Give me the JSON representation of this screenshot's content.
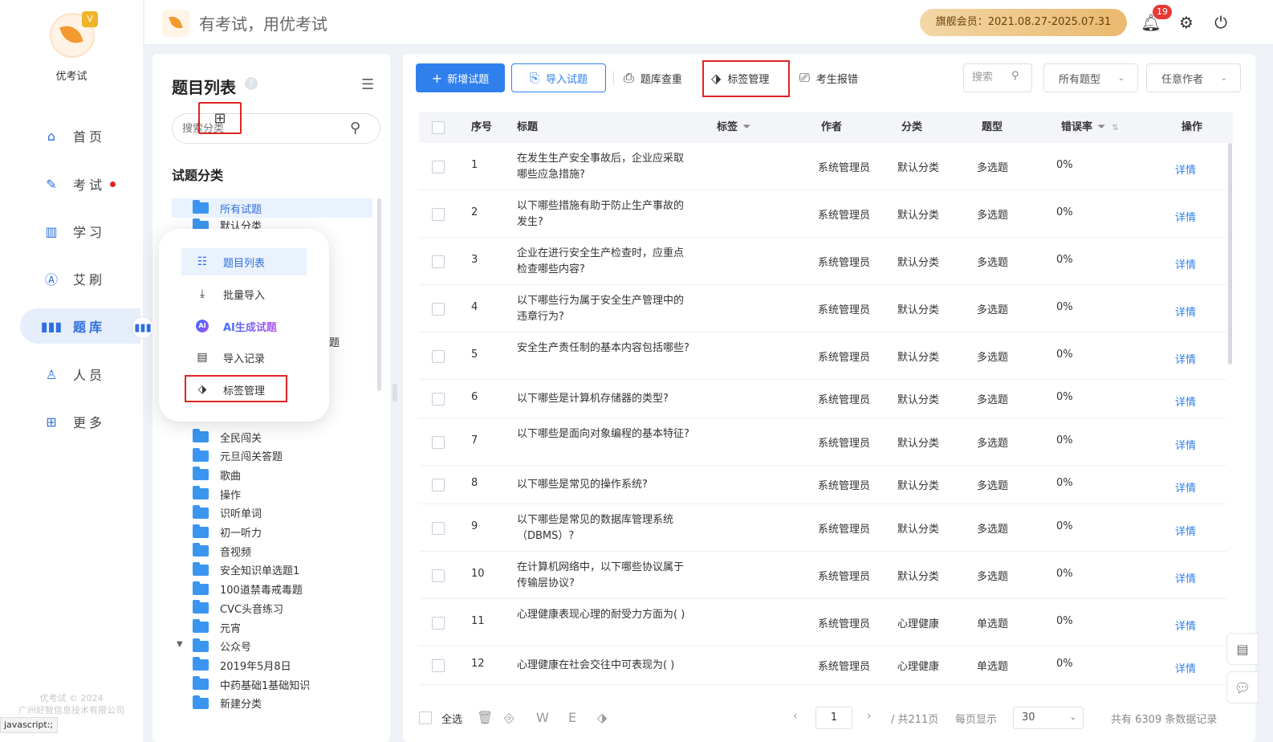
{
  "app": {
    "name": "优考试",
    "slogan": "有考试，用优考试",
    "logo_badge": "V"
  },
  "nav": {
    "items": [
      {
        "icon": "home-icon",
        "label": "首页"
      },
      {
        "icon": "exam-icon",
        "label": "考试"
      },
      {
        "icon": "book-icon",
        "label": "学习"
      },
      {
        "icon": "ai-brush-icon",
        "label": "艾刷"
      },
      {
        "icon": "question-bank-icon",
        "label": "题库"
      },
      {
        "icon": "user-icon",
        "label": "人员"
      },
      {
        "icon": "more-icon",
        "label": "更多"
      }
    ],
    "active": "题库",
    "copyright_line1": "优考试 © 2024",
    "copyright_line2": "广州好智信息技术有限公司"
  },
  "topbar": {
    "vip_text": "旗舰会员：2021.08.27-2025.07.31",
    "bell_count": "19"
  },
  "statusbar": "javascript:;",
  "midpanel": {
    "title": "题目列表",
    "help": "?",
    "search_placeholder": "搜索分类",
    "category_label": "试题分类",
    "categories_top": [
      "所有试题",
      "默认分类"
    ],
    "categories_bottom": [
      "全民闯关",
      "元旦闯关答题",
      "歌曲",
      "操作",
      "识听单词",
      "初一听力",
      "音视频",
      "安全知识单选题1",
      "100道禁毒戒毒题",
      "CVC头音练习",
      "元宵",
      "公众号",
      "2019年5月8日",
      "中药基础1基础知识",
      "新建分类"
    ],
    "behind_text": "题"
  },
  "popup": {
    "items": [
      "题目列表",
      "批量导入",
      "AI生成试题",
      "导入记录",
      "标签管理"
    ],
    "ai_icon_text": "AI"
  },
  "toolbar": {
    "add_label": "新增试题",
    "import_label": "导入试题",
    "dedupe_label": "题库查重",
    "tag_label": "标签管理",
    "report_label": "考生报错",
    "search_placeholder": "搜索",
    "type_filter": "所有题型",
    "author_filter": "任意作者"
  },
  "table": {
    "headers": {
      "seq": "序号",
      "title": "标题",
      "tag": "标签",
      "author": "作者",
      "category": "分类",
      "type": "题型",
      "error_rate": "错误率",
      "action": "操作"
    },
    "rows": [
      {
        "seq": "1",
        "title": "在发生生产安全事故后，企业应采取哪些应急措施?",
        "author": "系统管理员",
        "category": "默认分类",
        "type": "多选题",
        "error_rate": "0%",
        "action": "详情"
      },
      {
        "seq": "2",
        "title": "以下哪些措施有助于防止生产事故的发生?",
        "author": "系统管理员",
        "category": "默认分类",
        "type": "多选题",
        "error_rate": "0%",
        "action": "详情"
      },
      {
        "seq": "3",
        "title": "企业在进行安全生产检查时，应重点检查哪些内容?",
        "author": "系统管理员",
        "category": "默认分类",
        "type": "多选题",
        "error_rate": "0%",
        "action": "详情"
      },
      {
        "seq": "4",
        "title": "以下哪些行为属于安全生产管理中的违章行为?",
        "author": "系统管理员",
        "category": "默认分类",
        "type": "多选题",
        "error_rate": "0%",
        "action": "详情"
      },
      {
        "seq": "5",
        "title": "安全生产责任制的基本内容包括哪些?",
        "author": "系统管理员",
        "category": "默认分类",
        "type": "多选题",
        "error_rate": "0%",
        "action": "详情"
      },
      {
        "seq": "6",
        "title": "以下哪些是计算机存储器的类型?",
        "author": "系统管理员",
        "category": "默认分类",
        "type": "多选题",
        "error_rate": "0%",
        "action": "详情"
      },
      {
        "seq": "7",
        "title": "以下哪些是面向对象编程的基本特征?",
        "author": "系统管理员",
        "category": "默认分类",
        "type": "多选题",
        "error_rate": "0%",
        "action": "详情"
      },
      {
        "seq": "8",
        "title": "以下哪些是常见的操作系统?",
        "author": "系统管理员",
        "category": "默认分类",
        "type": "多选题",
        "error_rate": "0%",
        "action": "详情"
      },
      {
        "seq": "9",
        "title": "以下哪些是常见的数据库管理系统（DBMS）?",
        "author": "系统管理员",
        "category": "默认分类",
        "type": "多选题",
        "error_rate": "0%",
        "action": "详情"
      },
      {
        "seq": "10",
        "title": "在计算机网络中，以下哪些协议属于传输层协议?",
        "author": "系统管理员",
        "category": "默认分类",
        "type": "多选题",
        "error_rate": "0%",
        "action": "详情"
      },
      {
        "seq": "11",
        "title": "心理健康表现心理的耐受力方面为( )",
        "author": "系统管理员",
        "category": "心理健康",
        "type": "单选题",
        "error_rate": "0%",
        "action": "详情"
      },
      {
        "seq": "12",
        "title": "心理健康在社会交往中可表现为( )",
        "author": "系统管理员",
        "category": "心理健康",
        "type": "单选题",
        "error_rate": "0%",
        "action": "详情"
      }
    ]
  },
  "footer": {
    "select_all": "全选",
    "page": "1",
    "total_pages": "/ 共211页",
    "per_page_label": "每页显示",
    "per_page": "30",
    "total_records": "共有 6309 条数据记录"
  }
}
